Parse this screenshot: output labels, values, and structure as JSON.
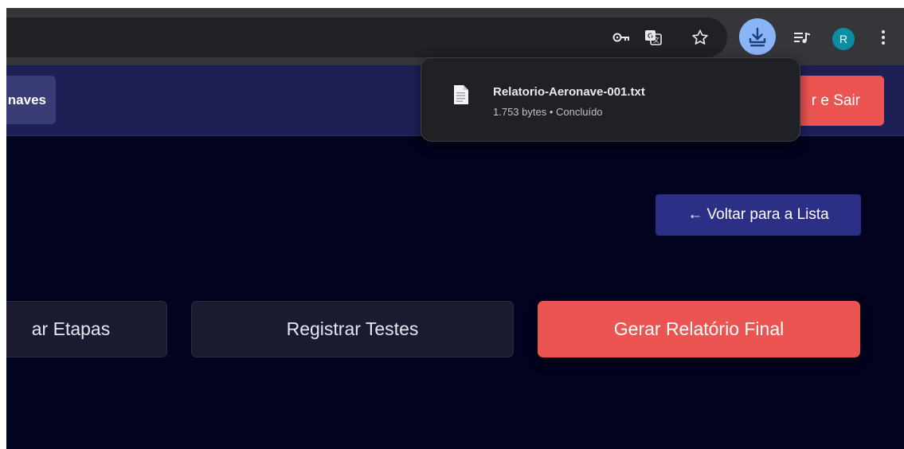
{
  "browser": {
    "icons": [
      "key-icon",
      "translate-icon",
      "star-icon",
      "download-icon",
      "media-icon",
      "profile-avatar",
      "kebab-menu-icon"
    ],
    "profile_initial": "R",
    "accent": "#8ab4f8"
  },
  "download_popup": {
    "file_name": "Relatorio-Aeronave-001.txt",
    "file_meta": "1.753 bytes • Concluído"
  },
  "navbar": {
    "left_label": "naves",
    "right_label": "r e Sair"
  },
  "main": {
    "back_label": "← Voltar para a Lista",
    "actions": [
      {
        "label": "ar Etapas"
      },
      {
        "label": "Registrar Testes"
      },
      {
        "label": "Gerar Relatório Final"
      }
    ]
  },
  "colors": {
    "page_bg": "#02031f",
    "navbar_bg": "#1d1f55",
    "danger": "#ec5451",
    "primary": "#2b2f86"
  }
}
